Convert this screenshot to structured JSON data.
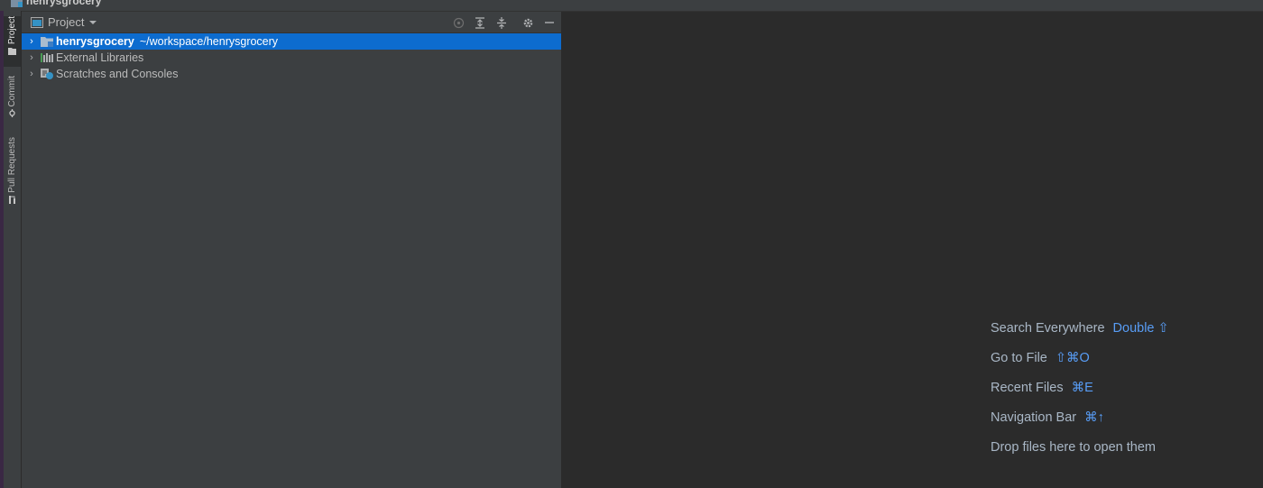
{
  "window": {
    "project_title": "henrysgrocery"
  },
  "stripe": {
    "tabs": [
      {
        "label": "Project",
        "icon": "folder-icon"
      },
      {
        "label": "Commit",
        "icon": "commit-icon"
      },
      {
        "label": "Pull Requests",
        "icon": "pull-request-icon"
      }
    ]
  },
  "panel": {
    "title": "Project",
    "header_buttons": [
      "locate-icon",
      "expand-all-icon",
      "collapse-all-icon",
      "gear-icon",
      "minimize-icon"
    ]
  },
  "tree": [
    {
      "name": "henrysgrocery",
      "path": "~/workspace/henrysgrocery",
      "selected": true,
      "icon": "folder-icon"
    },
    {
      "name": "External Libraries",
      "selected": false,
      "icon": "libraries-icon"
    },
    {
      "name": "Scratches and Consoles",
      "selected": false,
      "icon": "scratches-icon"
    }
  ],
  "editor": {
    "hints": [
      {
        "label": "Search Everywhere",
        "shortcut": "Double ⇧"
      },
      {
        "label": "Go to File",
        "shortcut": "⇧⌘O"
      },
      {
        "label": "Recent Files",
        "shortcut": "⌘E"
      },
      {
        "label": "Navigation Bar",
        "shortcut": "⌘↑"
      },
      {
        "label": "Drop files here to open them",
        "shortcut": ""
      }
    ]
  },
  "colors": {
    "selection": "#0d6ccf",
    "shortcut": "#589df6",
    "panel_bg": "#3c3f41",
    "editor_bg": "#2b2b2b"
  }
}
